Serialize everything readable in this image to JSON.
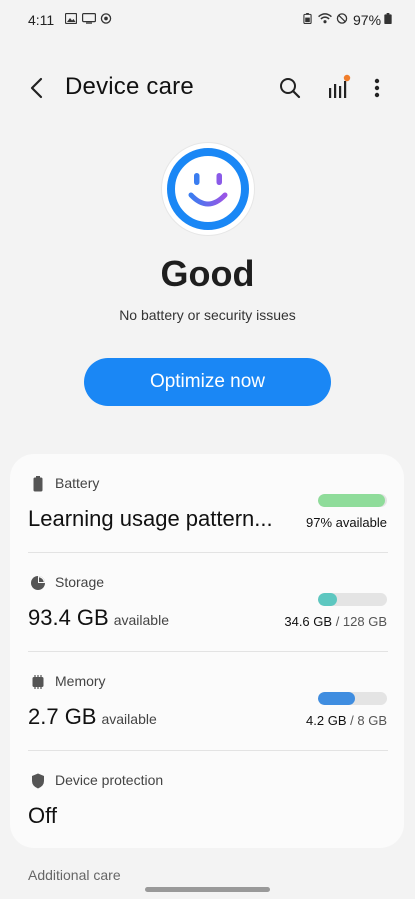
{
  "status_bar": {
    "time": "4:11",
    "battery_pct": "97%"
  },
  "app_bar": {
    "title": "Device care"
  },
  "hero": {
    "status": "Good",
    "subtitle": "No battery or security issues",
    "optimize_label": "Optimize now"
  },
  "items": {
    "battery": {
      "label": "Battery",
      "value": "Learning usage pattern...",
      "right": "97% available",
      "level": 0.97,
      "color": "#8fdc9a"
    },
    "storage": {
      "label": "Storage",
      "value": "93.4 GB",
      "value_suffix": "available",
      "used": "34.6 GB",
      "total": "/ 128 GB",
      "level": 0.27,
      "color": "#5dc7c0"
    },
    "memory": {
      "label": "Memory",
      "value": "2.7 GB",
      "value_suffix": "available",
      "used": "4.2 GB",
      "total": "/ 8 GB",
      "level": 0.53,
      "color": "#3f8de0"
    },
    "protection": {
      "label": "Device protection",
      "value": "Off"
    }
  },
  "additional_care": "Additional care",
  "colors": {
    "accent": "#1a87f5",
    "notification_dot": "#f07d2a"
  }
}
